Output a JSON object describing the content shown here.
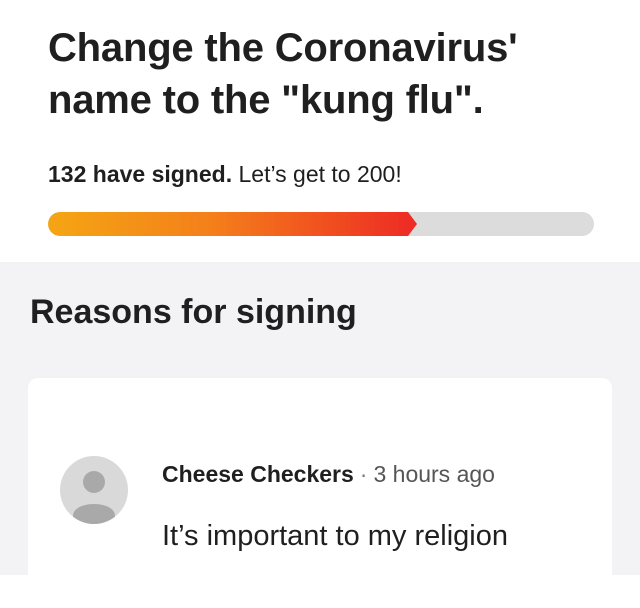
{
  "petition": {
    "title": "Change the Coronavirus' name to the \"kung flu\".",
    "signed_count": "132 have signed.",
    "goal_text": "Let’s get to 200!",
    "progress": 0.66,
    "progress_colors": [
      "#f5a514",
      "#f4801a",
      "#ee2d24"
    ]
  },
  "reasons": {
    "heading": "Reasons for signing",
    "comments": [
      {
        "author": "Cheese Checkers",
        "separator": "·",
        "time": "3 hours ago",
        "text": "It’s important to my religion",
        "avatar_icon": "user-avatar-icon"
      }
    ]
  }
}
